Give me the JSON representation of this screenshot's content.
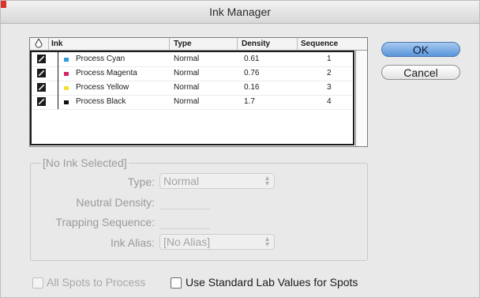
{
  "window": {
    "title": "Ink Manager"
  },
  "table": {
    "headers": [
      "Ink",
      "Type",
      "Density",
      "Sequence"
    ],
    "rows": [
      {
        "ink": "Process Cyan",
        "type": "Normal",
        "density": "0.61",
        "sequence": "1",
        "color": "#2a9ad8"
      },
      {
        "ink": "Process Magenta",
        "type": "Normal",
        "density": "0.76",
        "sequence": "2",
        "color": "#d8246a"
      },
      {
        "ink": "Process Yellow",
        "type": "Normal",
        "density": "0.16",
        "sequence": "3",
        "color": "#f2e233"
      },
      {
        "ink": "Process Black",
        "type": "Normal",
        "density": "1.7",
        "sequence": "4",
        "color": "#111111"
      }
    ]
  },
  "buttons": {
    "ok": "OK",
    "cancel": "Cancel"
  },
  "settings": {
    "group_title": "[No Ink Selected]",
    "type_label": "Type:",
    "type_value": "Normal",
    "neutral_density_label": "Neutral Density:",
    "trapping_sequence_label": "Trapping Sequence:",
    "ink_alias_label": "Ink Alias:",
    "ink_alias_value": "[No Alias]"
  },
  "options": {
    "all_spots": "All Spots to Process",
    "use_lab": "Use Standard Lab Values for Spots"
  }
}
